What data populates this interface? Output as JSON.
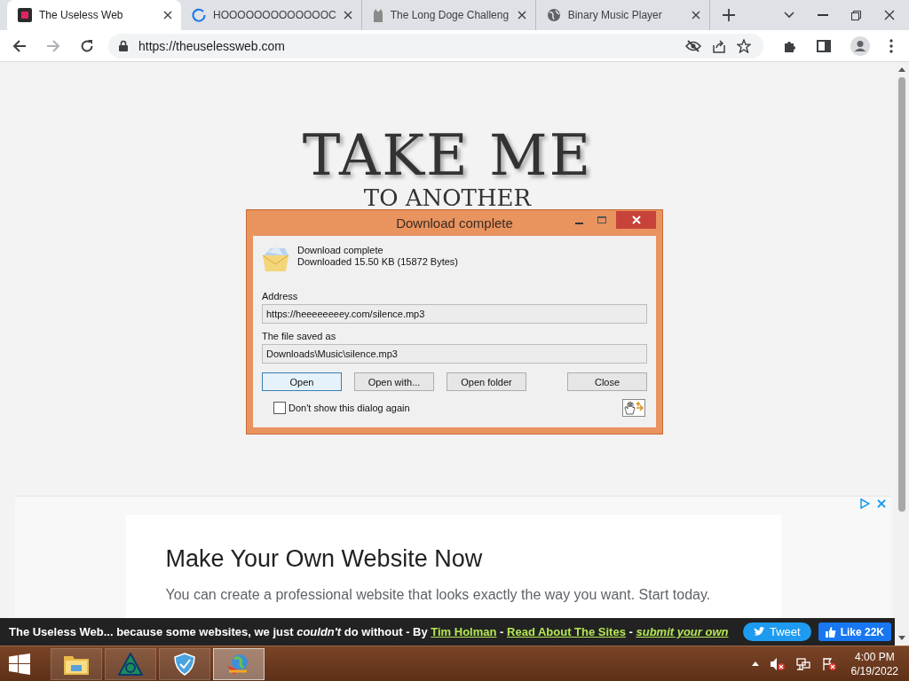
{
  "browser": {
    "tabs": [
      {
        "title": "The Useless Web",
        "kind": "app",
        "selected": true
      },
      {
        "title": "HOOOOOOOOOOOOOC",
        "kind": "loading",
        "selected": false
      },
      {
        "title": "The Long Doge Challeng",
        "kind": "image",
        "selected": false
      },
      {
        "title": "Binary Music Player",
        "kind": "globe",
        "selected": false
      }
    ],
    "address": "https://theuselessweb.com"
  },
  "page": {
    "heading": "TAKE ME",
    "subheading": "TO ANOTHER",
    "ad": {
      "title": "Make Your Own Website Now",
      "text": "You can create a professional website that looks exactly the way you want. Start today."
    },
    "footer": {
      "text": "The Useless Web... because some websites, we just *couldn't* do without - By ",
      "author": "Tim Holman",
      "separator_1": " - ",
      "about": "Read About The Sites",
      "separator_2": " - ",
      "submit": "submit your own",
      "tweet": "Tweet",
      "like": "Like 22K"
    }
  },
  "dialog": {
    "title": "Download complete",
    "status": "Download complete",
    "detail": "Downloaded 15.50  KB (15872 Bytes)",
    "address_label": "Address",
    "address": "https://heeeeeeeey.com/silence.mp3",
    "saved_label": "The file saved as",
    "saved_path": "Downloads\\Music\\silence.mp3",
    "buttons": [
      {
        "label": "Open",
        "selected": true
      },
      {
        "label": "Open with...",
        "selected": false
      },
      {
        "label": "Open folder",
        "selected": false
      },
      {
        "label": "Close",
        "selected": false
      }
    ],
    "checkbox": {
      "label": "Don't show this dialog again",
      "checked": false
    }
  },
  "taskbar": {
    "apps": [
      {
        "kind": "folder",
        "selected": false
      },
      {
        "kind": "triangle",
        "selected": false
      },
      {
        "kind": "shield",
        "selected": false
      },
      {
        "kind": "downloader",
        "selected": true
      }
    ],
    "time": "4:00 PM",
    "date": "6/19/2022"
  }
}
